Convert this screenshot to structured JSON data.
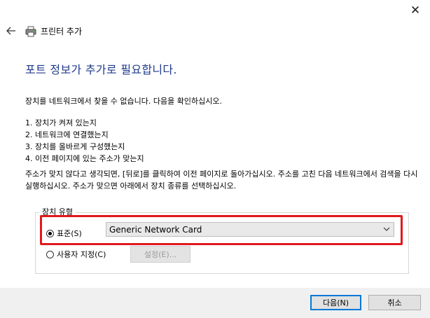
{
  "window": {
    "title": "프린터 추가",
    "close_glyph": "✕",
    "back_glyph": "←"
  },
  "page_title": "포트 정보가 추가로 필요합니다.",
  "description": "장치를 네트워크에서 찾을 수 없습니다. 다음을 확인하십시오.",
  "steps": [
    {
      "num": "1.",
      "text": "장치가 켜져 있는지"
    },
    {
      "num": "2.",
      "text": "네트워크에 연결했는지"
    },
    {
      "num": "3.",
      "text": "장치를 올바르게 구성했는지"
    },
    {
      "num": "4.",
      "text": "이전 페이지에 있는 주소가 맞는지"
    }
  ],
  "note": "주소가 맞지 않다고 생각되면, [뒤로]를 클릭하여 이전 페이지로 돌아가십시오. 주소를 고친 다음 네트워크에서 검색을 다시 실행하십시오. 주소가 맞으면 아래에서 장치 종류를 선택하십시오.",
  "device_type": {
    "group_label": "장치 유형",
    "standard_label": "표준(S)",
    "standard_selected": true,
    "custom_label": "사용자 지정(C)",
    "select_value": "Generic Network Card",
    "settings_label": "설정(E)..."
  },
  "footer": {
    "next_label": "다음(N)",
    "cancel_label": "취소"
  },
  "colors": {
    "title_blue": "#1f3a8c",
    "highlight_red": "#e0191d",
    "default_button_border": "#0078d7"
  }
}
